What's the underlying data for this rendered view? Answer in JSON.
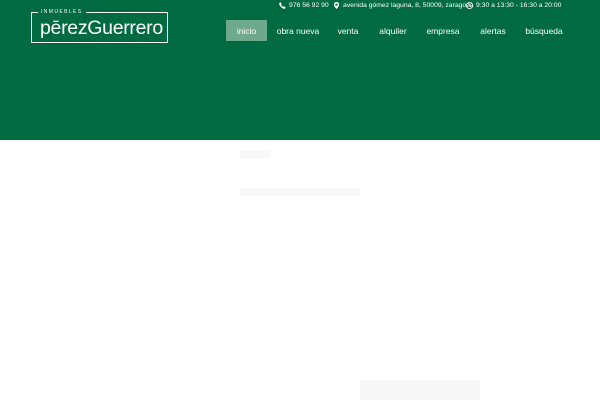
{
  "brand": {
    "tag": "INMUEBLES",
    "wordmark": "pērezGuerrero"
  },
  "topbar": {
    "phone": "976 56 92 90",
    "address": "avenida gómez laguna, 8, 50009, zaragoza",
    "hours": "9:30 a 13:30 - 16:30 a 20:00"
  },
  "nav": {
    "items": [
      {
        "label": "inicio",
        "active": true
      },
      {
        "label": "obra nueva"
      },
      {
        "label": "venta"
      },
      {
        "label": "alquiler"
      },
      {
        "label": "empresa"
      },
      {
        "label": "alertas"
      },
      {
        "label": "búsqueda"
      }
    ]
  },
  "colors": {
    "header_bg": "#006a40",
    "active_bg": "#6ea98b",
    "text": "#ffffff"
  },
  "icons": {
    "phone": "phone-icon",
    "address": "map-pin-icon",
    "hours": "clock-icon"
  }
}
